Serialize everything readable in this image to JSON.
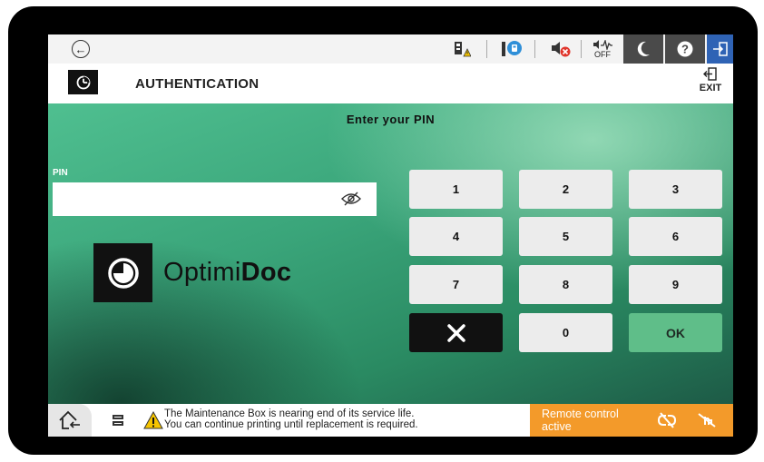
{
  "status_bar": {
    "icons": [
      "back-arrow-icon",
      "ink-warning-icon",
      "device-info-icon",
      "sound-muted-icon",
      "quiet-mode-off-icon",
      "sleep-moon-icon",
      "help-icon",
      "sign-out-icon"
    ],
    "quiet_label": "OFF"
  },
  "header": {
    "title": "AUTHENTICATION",
    "exit_label": "EXIT"
  },
  "main": {
    "prompt": "Enter your PIN",
    "pin_label": "PIN",
    "pin_value": "",
    "brand_light": "Optimi",
    "brand_bold": "Doc"
  },
  "keypad": {
    "k1": "1",
    "k2": "2",
    "k3": "3",
    "k4": "4",
    "k5": "5",
    "k6": "6",
    "k7": "7",
    "k8": "8",
    "k9": "9",
    "k0": "0",
    "ok": "OK"
  },
  "bottom_bar": {
    "message_line1": "The Maintenance Box is nearing end of its service life.",
    "message_line2": "You can continue printing until replacement is required.",
    "remote_line1": "Remote control",
    "remote_line2": "active"
  },
  "colors": {
    "accent_orange": "#f39a2a",
    "ok_green": "#5fbe89",
    "status_blue": "#2f63b5"
  }
}
